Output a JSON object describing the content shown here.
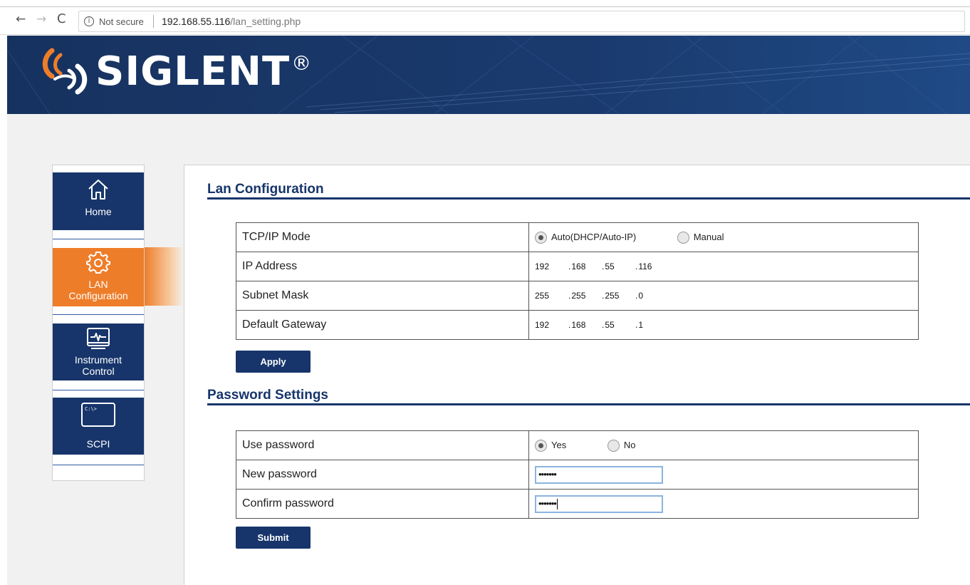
{
  "browser": {
    "not_secure": "Not secure",
    "url_host": "192.168.55.116",
    "url_path": "/lan_setting.php",
    "nav": {
      "back": "←",
      "forward": "→",
      "reload": "C",
      "info": "i"
    }
  },
  "brand": {
    "name": "SIGLENT",
    "reg_mark": "®"
  },
  "sidebar": {
    "items": [
      {
        "label": "Home",
        "icon": "home-icon"
      },
      {
        "label_1": "LAN",
        "label_2": "Configuration",
        "icon": "gear-icon"
      },
      {
        "label_1": "Instrument",
        "label_2": "Control",
        "icon": "monitor-pulse-icon"
      },
      {
        "label": "SCPI",
        "icon": "terminal-icon",
        "icon_text": "C:\\>"
      }
    ]
  },
  "lan": {
    "title": "Lan Configuration",
    "tcp_mode_label": "TCP/IP Mode",
    "mode_auto": "Auto(DHCP/Auto-IP)",
    "mode_manual": "Manual",
    "ip_label": "IP Address",
    "ip": [
      "192",
      "168",
      "55",
      "116"
    ],
    "subnet_label": "Subnet Mask",
    "subnet": [
      "255",
      "255",
      "255",
      "0"
    ],
    "gateway_label": "Default Gateway",
    "gateway": [
      "192",
      "168",
      "55",
      "1"
    ],
    "apply": "Apply"
  },
  "password": {
    "title": "Password Settings",
    "use_label": "Use password",
    "yes": "Yes",
    "no": "No",
    "new_label": "New password",
    "new_value": "•••••••",
    "confirm_label": "Confirm password",
    "confirm_value": "•••••••",
    "submit": "Submit"
  },
  "colors": {
    "navy": "#17356b",
    "orange": "#ee7d2a"
  }
}
